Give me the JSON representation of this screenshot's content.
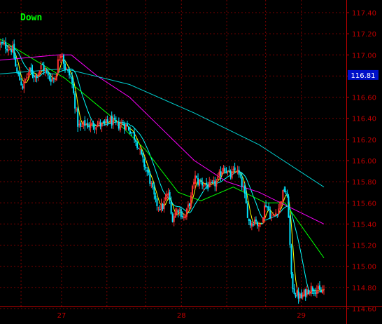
{
  "chart_data": {
    "type": "candlestick",
    "title": "Down",
    "ylim": [
      114.6,
      117.5
    ],
    "y_ticks": [
      "117.40",
      "117.20",
      "117.00",
      "116.80",
      "116.60",
      "116.40",
      "116.20",
      "116.00",
      "115.80",
      "115.60",
      "115.40",
      "115.20",
      "115.00",
      "114.80",
      "114.60"
    ],
    "y_tick_values": [
      117.4,
      117.2,
      117.0,
      116.8,
      116.6,
      116.4,
      116.2,
      116.0,
      115.8,
      115.6,
      115.4,
      115.2,
      115.0,
      114.8,
      114.6
    ],
    "x_ticks": [
      "27",
      "28",
      "29"
    ],
    "x_tick_positions": [
      0.19,
      0.56,
      0.93
    ],
    "last_price": "116.81",
    "last_price_value": 116.81,
    "grid": true,
    "colors": {
      "background": "#000000",
      "axis": "#c00000",
      "grid": "#7a0000",
      "up": "#ff3030",
      "down": "#00e5ff",
      "title": "#00ff00",
      "last_box": "#0010c8",
      "ma_short": "#ffff00",
      "ma_mid": "#00ffff",
      "ma_medium": "#00ff00",
      "ma_long": "#ff00ff",
      "ma_longer": "#00d0d0"
    },
    "close_path": [
      [
        0.0,
        117.1
      ],
      [
        0.02,
        117.08
      ],
      [
        0.04,
        117.05
      ],
      [
        0.05,
        116.85
      ],
      [
        0.07,
        116.7
      ],
      [
        0.09,
        116.85
      ],
      [
        0.11,
        116.8
      ],
      [
        0.13,
        116.9
      ],
      [
        0.15,
        116.78
      ],
      [
        0.17,
        116.78
      ],
      [
        0.18,
        116.95
      ],
      [
        0.19,
        117.05
      ],
      [
        0.2,
        116.88
      ],
      [
        0.22,
        116.78
      ],
      [
        0.24,
        116.35
      ],
      [
        0.25,
        116.3
      ],
      [
        0.26,
        116.35
      ],
      [
        0.28,
        116.33
      ],
      [
        0.3,
        116.35
      ],
      [
        0.32,
        116.33
      ],
      [
        0.34,
        116.38
      ],
      [
        0.36,
        116.33
      ],
      [
        0.38,
        116.35
      ],
      [
        0.4,
        116.3
      ],
      [
        0.42,
        116.2
      ],
      [
        0.44,
        116.0
      ],
      [
        0.46,
        115.85
      ],
      [
        0.48,
        115.6
      ],
      [
        0.5,
        115.55
      ],
      [
        0.52,
        115.7
      ],
      [
        0.53,
        115.45
      ],
      [
        0.55,
        115.55
      ],
      [
        0.57,
        115.45
      ],
      [
        0.59,
        115.65
      ],
      [
        0.6,
        115.85
      ],
      [
        0.61,
        115.8
      ],
      [
        0.63,
        115.78
      ],
      [
        0.65,
        115.75
      ],
      [
        0.67,
        115.8
      ],
      [
        0.69,
        115.95
      ],
      [
        0.71,
        115.85
      ],
      [
        0.73,
        115.92
      ],
      [
        0.75,
        115.75
      ],
      [
        0.77,
        115.4
      ],
      [
        0.79,
        115.45
      ],
      [
        0.8,
        115.35
      ],
      [
        0.82,
        115.6
      ],
      [
        0.84,
        115.45
      ],
      [
        0.86,
        115.55
      ],
      [
        0.88,
        115.75
      ],
      [
        0.89,
        115.55
      ],
      [
        0.9,
        114.85
      ],
      [
        0.91,
        114.75
      ],
      [
        0.93,
        114.7
      ],
      [
        0.95,
        114.78
      ],
      [
        0.97,
        114.8
      ],
      [
        0.99,
        114.75
      ],
      [
        1.0,
        114.78
      ]
    ],
    "ma_lines": [
      {
        "color_key": "ma_medium",
        "points": [
          [
            0.0,
            117.15
          ],
          [
            0.2,
            116.78
          ],
          [
            0.35,
            116.4
          ],
          [
            0.45,
            116.1
          ],
          [
            0.55,
            115.7
          ],
          [
            0.62,
            115.62
          ],
          [
            0.72,
            115.75
          ],
          [
            0.82,
            115.6
          ],
          [
            0.88,
            115.6
          ],
          [
            1.0,
            115.08
          ]
        ]
      },
      {
        "color_key": "ma_long",
        "points": [
          [
            0.0,
            116.95
          ],
          [
            0.18,
            117.0
          ],
          [
            0.22,
            117.0
          ],
          [
            0.3,
            116.8
          ],
          [
            0.4,
            116.6
          ],
          [
            0.5,
            116.3
          ],
          [
            0.6,
            116.0
          ],
          [
            0.7,
            115.8
          ],
          [
            0.8,
            115.7
          ],
          [
            0.9,
            115.55
          ],
          [
            1.0,
            115.4
          ]
        ]
      },
      {
        "color_key": "ma_longer",
        "points": [
          [
            0.0,
            116.82
          ],
          [
            0.2,
            116.87
          ],
          [
            0.4,
            116.72
          ],
          [
            0.6,
            116.45
          ],
          [
            0.8,
            116.15
          ],
          [
            1.0,
            115.75
          ]
        ]
      }
    ]
  }
}
